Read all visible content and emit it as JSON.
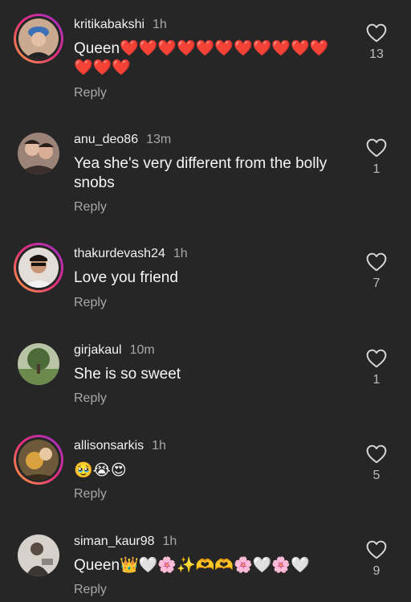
{
  "comments": [
    {
      "username": "kritikabakshi",
      "time": "1h",
      "text": "Queen❤️❤️❤️❤️❤️❤️❤️❤️❤️❤️❤️❤️❤️❤️",
      "reply": "Reply",
      "likes": "13",
      "avatar_color": "#3b6fb6",
      "has_story_ring": true
    },
    {
      "username": "anu_deo86",
      "time": "13m",
      "text": "Yea she's very different from the bolly snobs",
      "reply": "Reply",
      "likes": "1",
      "avatar_color": "#8a6d62",
      "has_story_ring": false
    },
    {
      "username": "thakurdevash24",
      "time": "1h",
      "text": "Love you friend",
      "reply": "Reply",
      "likes": "7",
      "avatar_color": "#d9d2cc",
      "has_story_ring": true
    },
    {
      "username": "girjakaul",
      "time": "10m",
      "text": "She is so sweet",
      "reply": "Reply",
      "likes": "1",
      "avatar_color": "#6f8a55",
      "has_story_ring": false
    },
    {
      "username": "allisonsarkis",
      "time": "1h",
      "text": "🥹😭😍",
      "reply": "Reply",
      "likes": "5",
      "avatar_color": "#b58a3a",
      "has_story_ring": true
    },
    {
      "username": "siman_kaur98",
      "time": "1h",
      "text": "Queen👑🤍🌸✨🫶🫶🌸🤍🌸🤍",
      "reply": "Reply",
      "likes": "9",
      "avatar_color": "#cfcac4",
      "has_story_ring": false
    }
  ]
}
